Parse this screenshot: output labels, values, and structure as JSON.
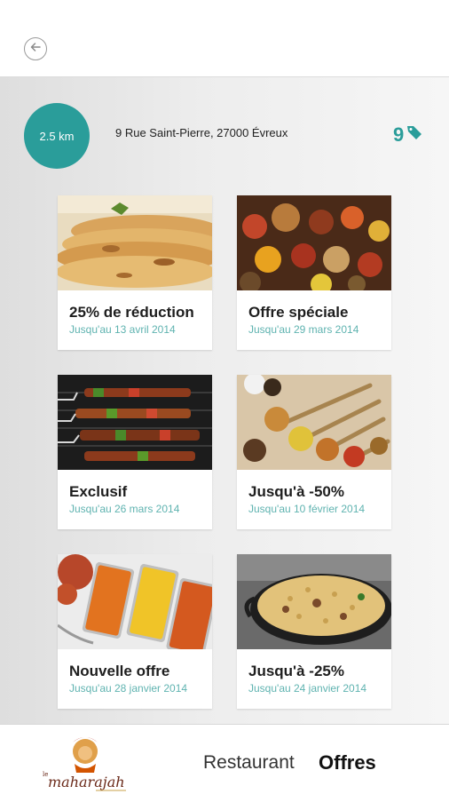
{
  "header": {
    "back_icon": "back-arrow-icon"
  },
  "info": {
    "distance": "2.5 km",
    "address": "9 Rue Saint-Pierre, 27000 Évreux",
    "offer_count": "9",
    "offer_icon": "tag-icon",
    "accent_color": "#2a9d9a"
  },
  "offers": [
    {
      "title": "25% de réduction",
      "date": "Jusqu'au 13 avril 2014"
    },
    {
      "title": "Offre spéciale",
      "date": "Jusqu'au 29 mars 2014"
    },
    {
      "title": "Exclusif",
      "date": "Jusqu'au 26 mars 2014"
    },
    {
      "title": "Jusqu'à -50%",
      "date": "Jusqu'au 10 février 2014"
    },
    {
      "title": "Nouvelle offre",
      "date": "Jusqu'au 28 janvier 2014"
    },
    {
      "title": "Jusqu'à -25%",
      "date": "Jusqu'au 24 janvier 2014"
    }
  ],
  "footer": {
    "logo_text": "Maharajah",
    "nav_restaurant": "Restaurant",
    "nav_offres": "Offres"
  }
}
